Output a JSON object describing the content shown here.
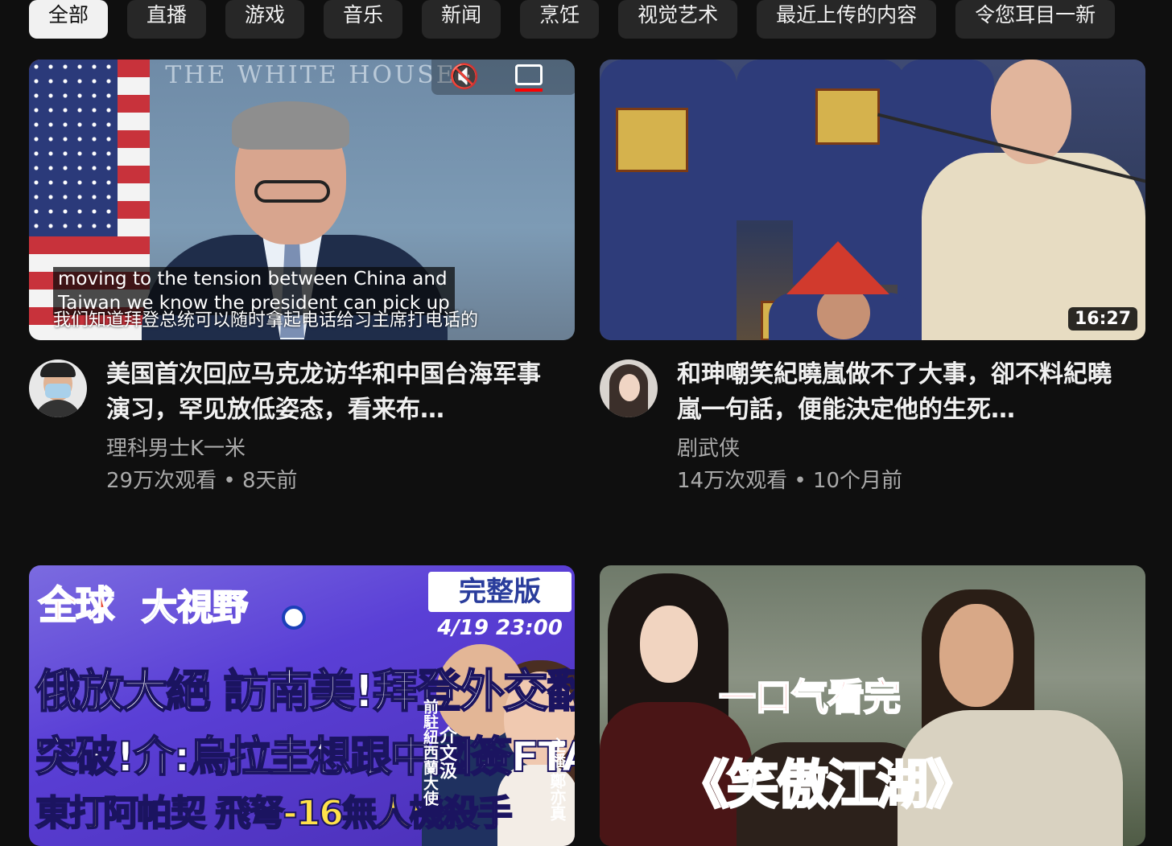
{
  "chips": [
    {
      "label": "全部",
      "active": true
    },
    {
      "label": "直播"
    },
    {
      "label": "游戏"
    },
    {
      "label": "音乐"
    },
    {
      "label": "新闻"
    },
    {
      "label": "烹饪"
    },
    {
      "label": "视觉艺术"
    },
    {
      "label": "最近上传的内容"
    },
    {
      "label": "令您耳目一新"
    }
  ],
  "videos": [
    {
      "title": "美国首次回应马克龙访华和中国台海军事演习，罕见放低姿态，看来布…",
      "channel": "理科男士K一米",
      "stats": "29万次观看 • 8天前",
      "thumb": {
        "seal_text": "THE WHITE HOUSE",
        "caption_line1": "moving to the tension between China and",
        "caption_line2": "Taiwan we know the president can pick up",
        "hardsub": "我们知道拜登总统可以随时拿起电话给习主席打电话的"
      }
    },
    {
      "title": "和珅嘲笑紀曉嵐做不了大事，卻不料紀曉嵐一句話，便能決定他的生死…",
      "channel": "剧武侠",
      "stats": "14万次观看 • 10个月前",
      "duration": "16:27"
    },
    {
      "thumb": {
        "logo_quan": "全球",
        "logo_shiye": "大視野",
        "badge_full": "完整版",
        "badge_date": "4/19 23:00",
        "headline1": "俄放大絕 訪南美!拜登外交翻車",
        "headline2": "突破!介:烏拉圭想跟中國簽FTA",
        "headline3": "東打阿帕契 飛弩-16無人機殺手",
        "guest_label": "前駐紐西蘭大使",
        "guest_name": "介文汲",
        "host_label": "主播",
        "host_name": "鄭亦真"
      }
    },
    {
      "thumb": {
        "overlay_red": "一口气看完",
        "overlay_black": "《笑傲江湖》"
      }
    }
  ],
  "colors": {
    "background": "#0f0f0f",
    "chip": "#272727",
    "chip_active": "#f1f1f1",
    "secondary_text": "#aaaaaa"
  }
}
